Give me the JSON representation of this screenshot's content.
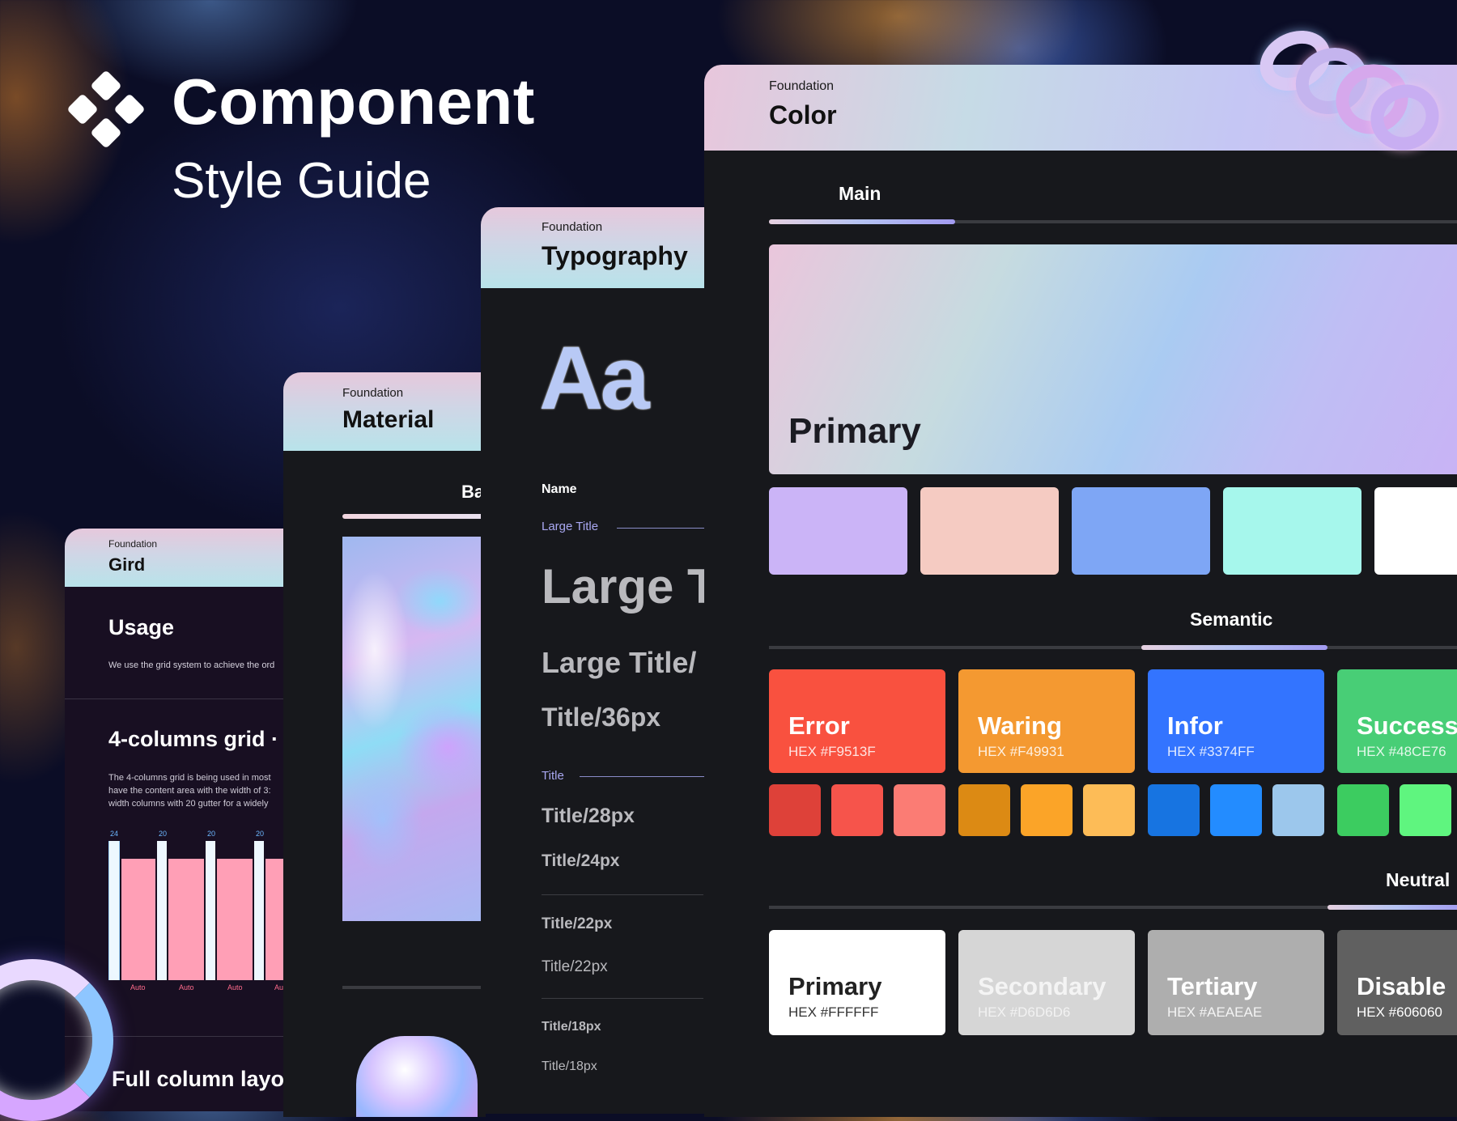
{
  "brand": {
    "title": "Component",
    "subtitle": "Style Guide",
    "icon": "diamond-cluster-logo"
  },
  "grid_card": {
    "kicker": "Foundation",
    "title": "Gird",
    "usage_heading": "Usage",
    "usage_text": "We use the grid system to achieve the ord",
    "section_heading": "4-columns grid ·",
    "section_text_1": "The 4-columns grid is being used in most",
    "section_text_2": "have the content area with the width of 3:",
    "section_text_3": "width columns with 20 gutter for a widely",
    "gutter_labels": [
      "24",
      "20",
      "20",
      "20"
    ],
    "column_labels": [
      "Auto",
      "Auto",
      "Auto",
      "Au"
    ],
    "bottom_heading": "Full column layo"
  },
  "material_card": {
    "kicker": "Foundation",
    "title": "Material",
    "tab_label": "Ba"
  },
  "typography_card": {
    "kicker": "Foundation",
    "title": "Typography",
    "glyph": "Aa",
    "name_label": "Name",
    "large_title_label": "Large Title",
    "large_title_sample": "Large T",
    "large_title_sub": "Large Title/",
    "title36": "Title/36px",
    "title_label": "Title",
    "title28": "Title/28px",
    "title24": "Title/24px",
    "title22a": "Title/22px",
    "title22b": "Title/22px",
    "title18a": "Title/18px",
    "title18b": "Title/18px"
  },
  "color_card": {
    "kicker": "Foundation",
    "title": "Color",
    "main_tab": "Main",
    "primary_label": "Primary",
    "primary_swatches": [
      "#cbb4f7",
      "#f5cbc2",
      "#7ea6f5",
      "#a6f7ec",
      "#ffffff"
    ],
    "semantic_tab": "Semantic",
    "semantic": [
      {
        "name": "Error",
        "hex": "HEX #F9513F",
        "color": "#f9513f",
        "shades": [
          "#de4139",
          "#f6544b",
          "#fb7c74"
        ]
      },
      {
        "name": "Waring",
        "hex": "HEX #F49931",
        "color": "#f49931",
        "shades": [
          "#dc8a14",
          "#fba428",
          "#fdbc57"
        ]
      },
      {
        "name": "Infor",
        "hex": "HEX #3374FF",
        "color": "#3374ff",
        "shades": [
          "#1774e1",
          "#238cff",
          "#9cc7ec"
        ]
      },
      {
        "name": "Success",
        "hex": "HEX #48CE76",
        "color": "#48ce76",
        "shades": [
          "#3ccc60",
          "#5ff57f"
        ]
      }
    ],
    "neutral_tab": "Neutral",
    "neutral": [
      {
        "name": "Primary",
        "hex": "HEX #FFFFFF",
        "color": "#ffffff",
        "text": "#222222",
        "subtext": "#333333"
      },
      {
        "name": "Secondary",
        "hex": "HEX #D6D6D6",
        "color": "#d6d6d6",
        "text": "#f4f4f4",
        "subtext": "#f2f2f2"
      },
      {
        "name": "Tertiary",
        "hex": "HEX #AEAEAE",
        "color": "#aeaeae",
        "text": "#ffffff",
        "subtext": "#f4f4f4"
      },
      {
        "name": "Disable",
        "hex": "HEX #606060",
        "color": "#606060",
        "text": "#ffffff",
        "subtext": "#ffffff"
      }
    ]
  }
}
